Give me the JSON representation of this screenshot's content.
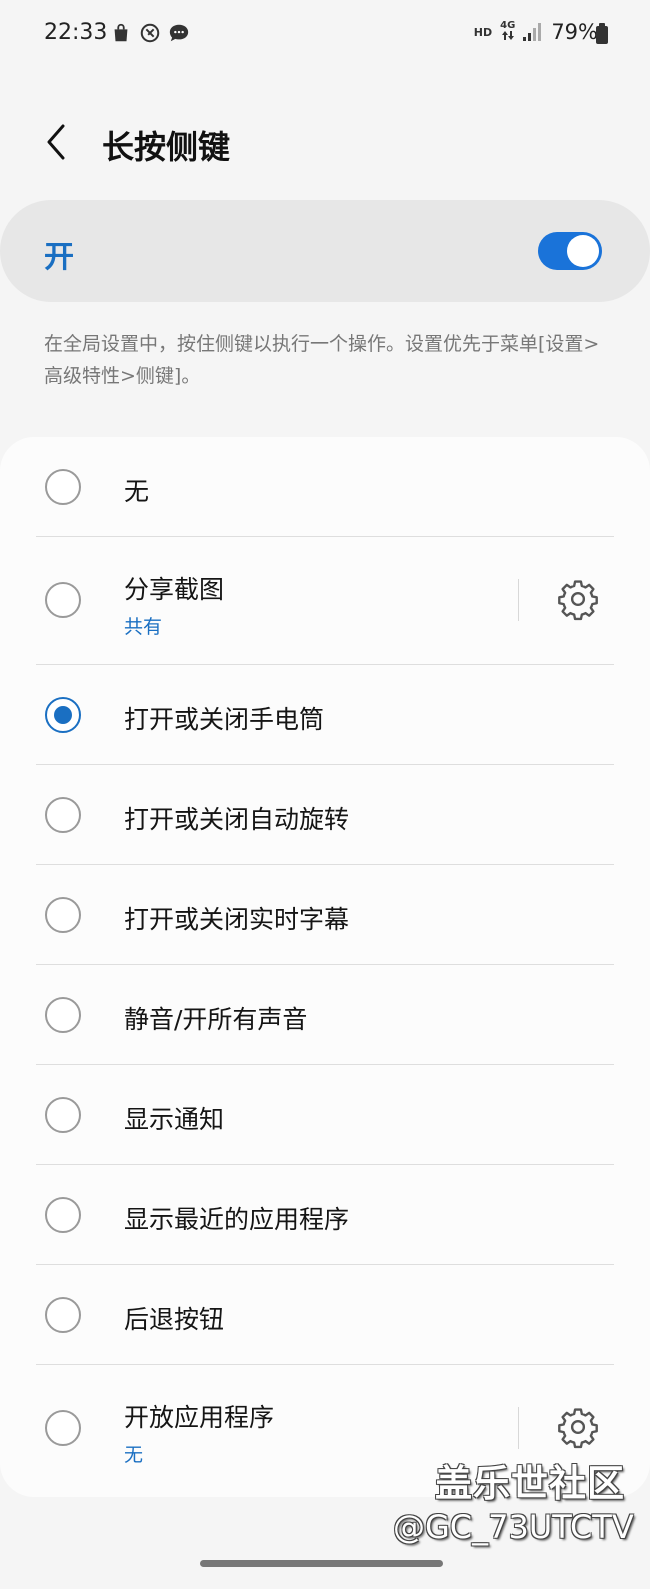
{
  "status_bar": {
    "time": "22:33",
    "left_icons": [
      "shopping-bag-icon",
      "no-location-icon",
      "chat-bubble-icon"
    ],
    "hd_badge": "HD",
    "network_badge": "4G",
    "battery_text": "79%"
  },
  "header": {
    "back_icon": "chevron-left-icon",
    "title": "长按侧键"
  },
  "master_switch": {
    "label": "开",
    "state": true,
    "accent_color": "#1a73d9"
  },
  "description": "在全局设置中，按住侧键以执行一个操作。设置优先于菜单[设置>高级特性>侧键]。",
  "options": [
    {
      "label": "无",
      "sub": "",
      "selected": false,
      "has_settings": false
    },
    {
      "label": "分享截图",
      "sub": "共有",
      "selected": false,
      "has_settings": true
    },
    {
      "label": "打开或关闭手电筒",
      "sub": "",
      "selected": true,
      "has_settings": false
    },
    {
      "label": "打开或关闭自动旋转",
      "sub": "",
      "selected": false,
      "has_settings": false
    },
    {
      "label": "打开或关闭实时字幕",
      "sub": "",
      "selected": false,
      "has_settings": false
    },
    {
      "label": "静音/开所有声音",
      "sub": "",
      "selected": false,
      "has_settings": false
    },
    {
      "label": "显示通知",
      "sub": "",
      "selected": false,
      "has_settings": false
    },
    {
      "label": "显示最近的应用程序",
      "sub": "",
      "selected": false,
      "has_settings": false
    },
    {
      "label": "后退按钮",
      "sub": "",
      "selected": false,
      "has_settings": false
    },
    {
      "label": "开放应用程序",
      "sub": "无",
      "selected": false,
      "has_settings": true
    }
  ],
  "watermark": {
    "line1": "盖乐世社区",
    "line2": "@GC_73UTCTV"
  }
}
